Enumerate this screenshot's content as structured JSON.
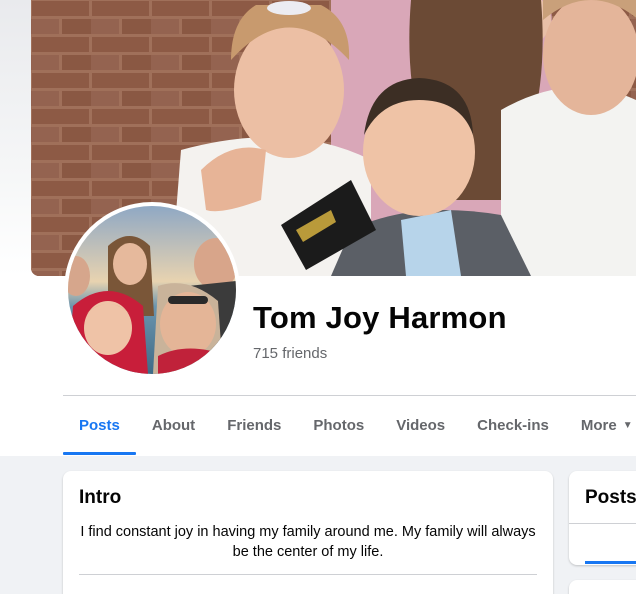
{
  "profile": {
    "name": "Tom Joy Harmon",
    "friends_count": "715 friends"
  },
  "tabs": [
    {
      "label": "Posts",
      "active": true
    },
    {
      "label": "About",
      "active": false
    },
    {
      "label": "Friends",
      "active": false
    },
    {
      "label": "Photos",
      "active": false
    },
    {
      "label": "Videos",
      "active": false
    },
    {
      "label": "Check-ins",
      "active": false
    },
    {
      "label": "More",
      "active": false
    }
  ],
  "intro": {
    "title": "Intro",
    "bio": "I find constant joy in having my family around me. My family will always be the center of my life."
  },
  "posts_panel": {
    "title": "Posts"
  },
  "colors": {
    "accent": "#1877f2",
    "page_bg": "#f0f2f5",
    "text_primary": "#050505",
    "text_secondary": "#65676b"
  }
}
